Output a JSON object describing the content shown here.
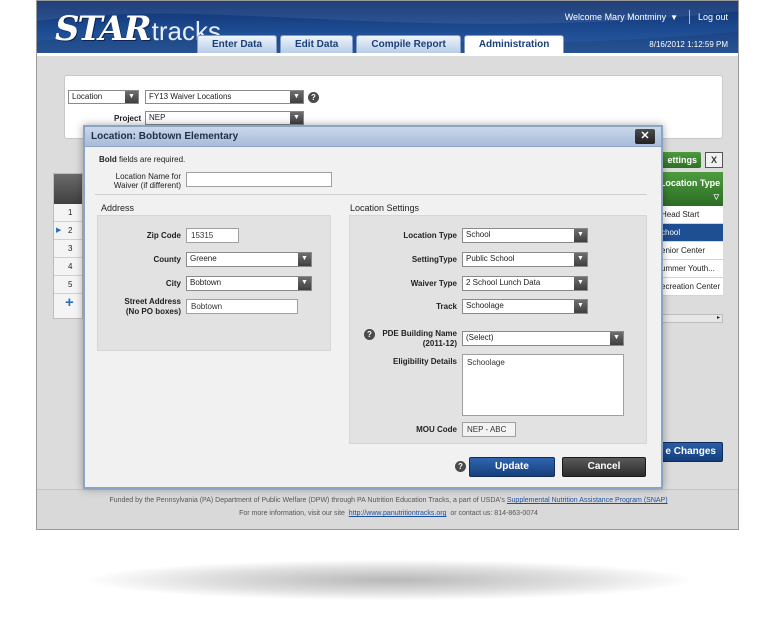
{
  "header": {
    "logo_star": "STAR",
    "logo_tracks": "tracks",
    "welcome": "Welcome Mary Montminy",
    "logout": "Log out",
    "datetime": "8/16/2012 1:12:59 PM",
    "tabs": [
      {
        "label": "Enter Data",
        "active": false
      },
      {
        "label": "Edit Data",
        "active": false
      },
      {
        "label": "Compile Report",
        "active": false
      },
      {
        "label": "Administration",
        "active": true
      }
    ]
  },
  "filters": {
    "entity_select": "Location",
    "list_select": "FY13 Waiver Locations",
    "project_label": "Project",
    "project_select": "NEP"
  },
  "left_grid": {
    "rows": [
      "1",
      "2",
      "3",
      "4",
      "5"
    ],
    "selected_row": "2",
    "add_icon": "+"
  },
  "right_panel": {
    "settings_label": "ettings",
    "column_header": "Location Type",
    "rows": [
      "Head Start",
      "chool",
      "enior Center",
      "ummer Youth...",
      "ecreation Center"
    ],
    "selected_index": 1,
    "save_label": "e Changes"
  },
  "dialog": {
    "title": "Location: Bobtown Elementary",
    "close_icon": "✕",
    "required_bold": "Bold",
    "required_rest": "fields are required.",
    "name_label": "Location Name for Waiver (if different)",
    "name_value": "",
    "address": {
      "title": "Address",
      "zip_label": "Zip Code",
      "zip_value": "15315",
      "county_label": "County",
      "county_value": "Greene",
      "city_label": "City",
      "city_value": "Bobtown",
      "street_label": "Street Address",
      "street_sub": "(No PO boxes)",
      "street_value": "Bobtown"
    },
    "settings": {
      "title": "Location Settings",
      "type_label": "Location Type",
      "type_value": "School",
      "setting_label": "SettingType",
      "setting_value": "Public School",
      "waiver_label": "Waiver Type",
      "waiver_value": "2 School Lunch Data",
      "track_label": "Track",
      "track_value": "Schoolage",
      "pde_label": "PDE Building Name",
      "pde_sub": "(2011-12)",
      "pde_value": "(Select)",
      "elig_label": "Eligibility Details",
      "elig_value": "Schoolage",
      "mou_label": "MOU Code",
      "mou_value": "NEP - ABC"
    },
    "update_label": "Update",
    "cancel_label": "Cancel"
  },
  "footer": {
    "line1_text": "Funded by the Pennsylvania (PA) Department of Public Welfare (DPW) through PA Nutrition Education Tracks, a part of USDA's",
    "line1_link": "Supplemental Nutrition Assistance Program (SNAP)",
    "line2_text": "For more information, visit our site",
    "line2_link": "http://www.panutritiontracks.org",
    "line2_contact": "or contact us: 814-863-0074"
  },
  "colors": {
    "header_blue": "#1d4b92",
    "accent_green": "#3f8a33",
    "button_blue": "#1e4f92",
    "button_dark": "#2b2b2b"
  },
  "icons": {
    "help": "?",
    "dropdown": "▼",
    "row_pointer": "▶",
    "filter": "▽",
    "scroll_right": "▸",
    "excel": "X"
  }
}
